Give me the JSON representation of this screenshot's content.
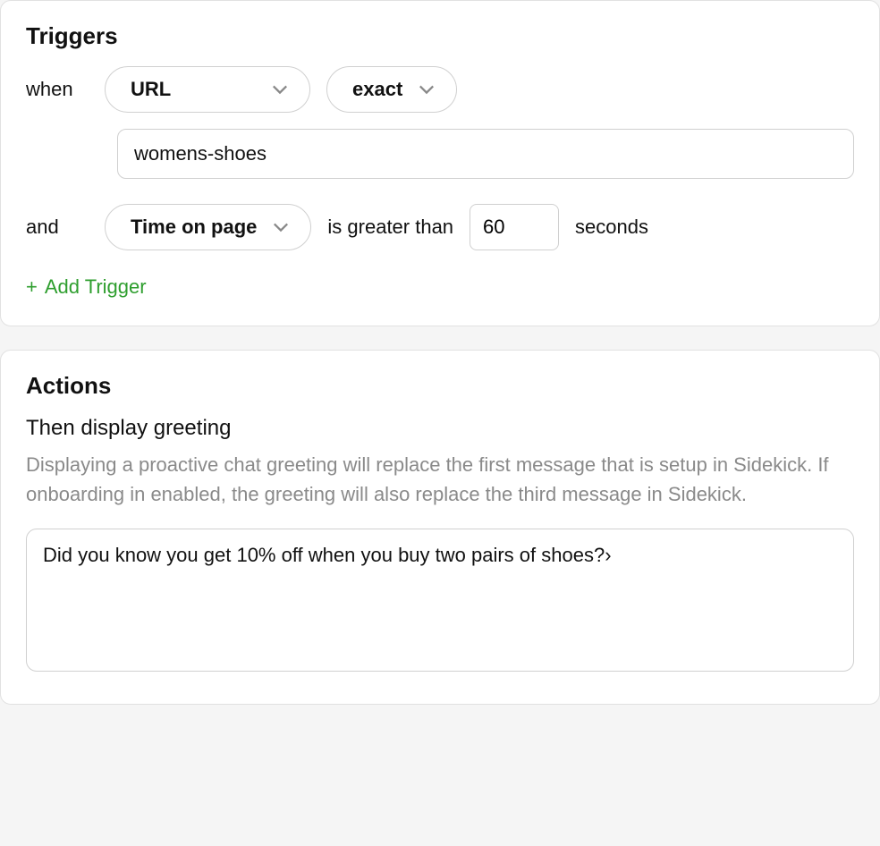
{
  "triggers": {
    "title": "Triggers",
    "when_label": "when",
    "and_label": "and",
    "url_select": "URL",
    "match_select": "exact",
    "url_value": "womens-shoes",
    "time_select": "Time on page",
    "compare_text": "is greater than",
    "seconds_value": "60",
    "seconds_unit": "seconds",
    "add_trigger_label": "Add Trigger"
  },
  "actions": {
    "title": "Actions",
    "subheading": "Then display greeting",
    "help": "Displaying a proactive chat greeting will replace the first message that is setup in Sidekick. If onboarding in enabled, the greeting will also replace the third message in Sidekick.",
    "greeting_value": "Did you know you get 10% off when you buy two pairs of shoes?›"
  }
}
